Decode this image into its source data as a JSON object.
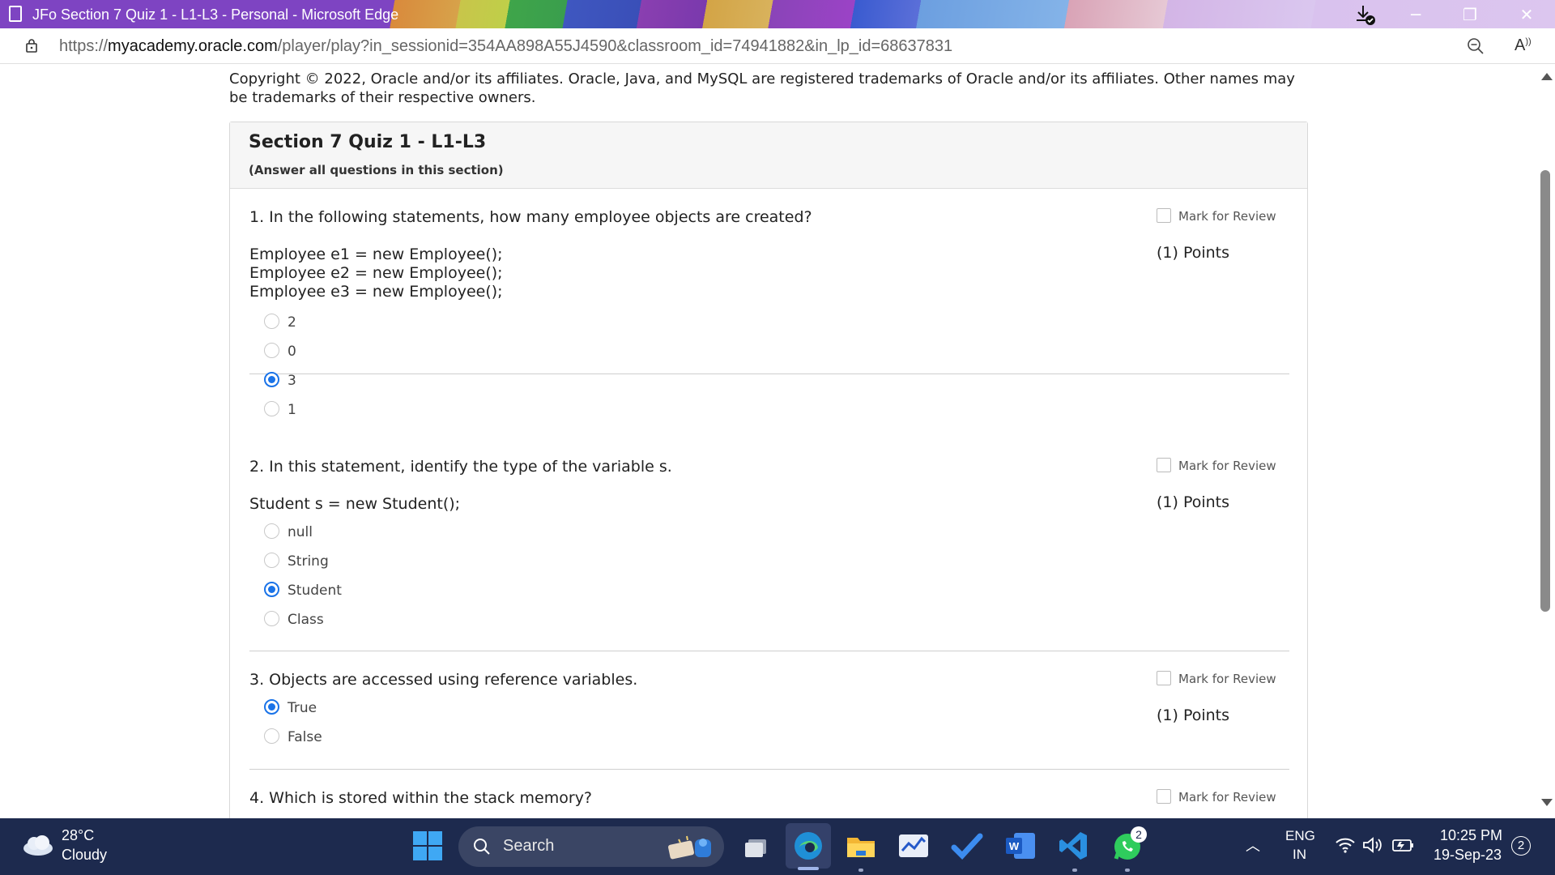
{
  "window": {
    "title": "JFo Section 7 Quiz 1 - L1-L3 - Personal - Microsoft Edge"
  },
  "address": {
    "url_prefix": "https://",
    "url_host": "myacademy.oracle.com",
    "url_path": "/player/play?in_sessionid=354AA898A55J4590&classroom_id=74941882&in_lp_id=68637831"
  },
  "page": {
    "copyright": "Copyright © 2022, Oracle and/or its affiliates. Oracle, Java, and MySQL are registered trademarks of Oracle and/or its affiliates. Other names may be trademarks of their respective owners.",
    "quiz_title": "Section 7 Quiz 1 - L1-L3",
    "quiz_subtitle": "(Answer all questions in this section)",
    "mark_label": "Mark for Review",
    "points_label": "(1) Points",
    "questions": [
      {
        "text": "1. In the following statements, how many employee objects are created?",
        "code": "Employee e1 = new Employee();\nEmployee e2 = new Employee();\nEmployee e3 = new Employee();",
        "options": [
          {
            "label": "2",
            "checked": false
          },
          {
            "label": "0",
            "checked": false
          },
          {
            "label": "3",
            "checked": true
          },
          {
            "label": "1",
            "checked": false
          }
        ]
      },
      {
        "text": "2. In this statement, identify the type of the variable s.",
        "code": "Student s = new Student();",
        "options": [
          {
            "label": "null",
            "checked": false
          },
          {
            "label": "String",
            "checked": false
          },
          {
            "label": "Student",
            "checked": true
          },
          {
            "label": "Class",
            "checked": false
          }
        ]
      },
      {
        "text": "3. Objects are accessed using reference variables.",
        "code": "",
        "options": [
          {
            "label": "True",
            "checked": true
          },
          {
            "label": "False",
            "checked": false
          }
        ]
      },
      {
        "text": "4. Which is stored within the stack memory?",
        "code": "",
        "options": []
      }
    ]
  },
  "taskbar": {
    "temperature": "28°C",
    "condition": "Cloudy",
    "search_label": "Search",
    "whatsapp_badge": "2",
    "lang_top": "ENG",
    "lang_bottom": "IN",
    "time": "10:25 PM",
    "date": "19-Sep-23",
    "notifications": "2",
    "icons": [
      "widgets-icon",
      "task-view-icon",
      "edge-icon",
      "file-explorer-icon",
      "stocks-icon",
      "todo-icon",
      "word-icon",
      "vscode-icon",
      "whatsapp-icon"
    ]
  },
  "colors": {
    "accent_radio": "#1a73e8",
    "taskbar_bg": "#1d2a4e"
  }
}
